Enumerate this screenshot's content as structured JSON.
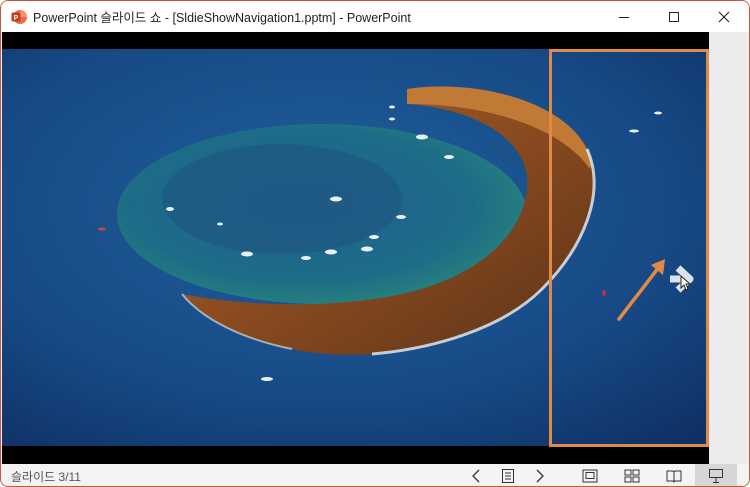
{
  "window": {
    "title": "PowerPoint 슬라이드 쇼 - [SldieShowNavigation1.pptm] - PowerPoint"
  },
  "slide": {
    "image": "aerial-crescent-island-photo"
  },
  "status": {
    "slide_counter": "슬라이드 3/11"
  },
  "colors": {
    "accent": "#e08a45",
    "window_border": "#c8553d",
    "ppt_red": "#c43e1c"
  }
}
